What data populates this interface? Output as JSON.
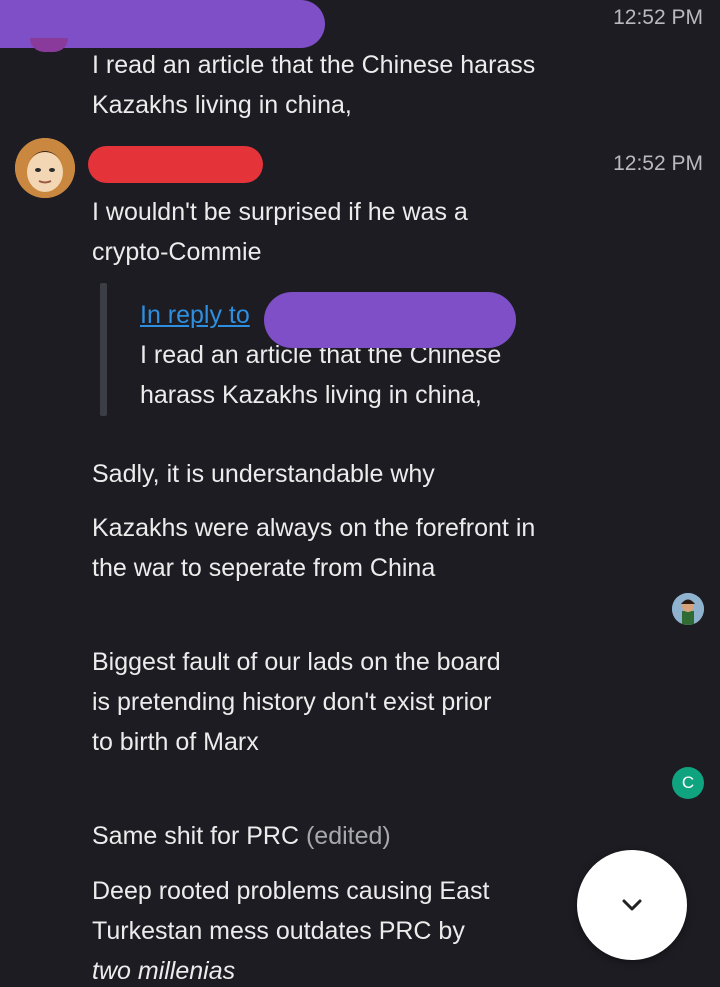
{
  "messages": [
    {
      "time": "12:52 PM",
      "lines": [
        "I read an article that the Chinese harass",
        "Kazakhs living in china,"
      ]
    },
    {
      "time": "12:52 PM",
      "lines": [
        "I wouldn't be surprised if he was a",
        "crypto-Commie"
      ],
      "reply": {
        "link": "In reply to",
        "quote_lines": [
          "I read an article that the Chinese",
          "harass Kazakhs living in china,"
        ]
      }
    },
    {
      "lines": [
        "Sadly, it is understandable why"
      ]
    },
    {
      "lines": [
        "Kazakhs were always on the forefront in",
        "the war to seperate from China"
      ]
    },
    {
      "lines": [
        "Biggest fault of our lads on the board",
        "is pretending history don't exist prior",
        "to birth of Marx"
      ]
    },
    {
      "text": "Same shit for PRC",
      "edited": "(edited)"
    },
    {
      "lines": [
        "Deep rooted problems causing East",
        "Turkestan mess outdates PRC by"
      ],
      "italic_line": "two millenias"
    }
  ],
  "read_badge": "C",
  "colors": {
    "background": "#1c1c22",
    "link": "#2e8fe0",
    "redact_purple": "#7e4fc6",
    "redact_red": "#e5333a",
    "badge": "#10a37f"
  },
  "icons": {
    "scroll_down": "chevron-down-icon"
  }
}
